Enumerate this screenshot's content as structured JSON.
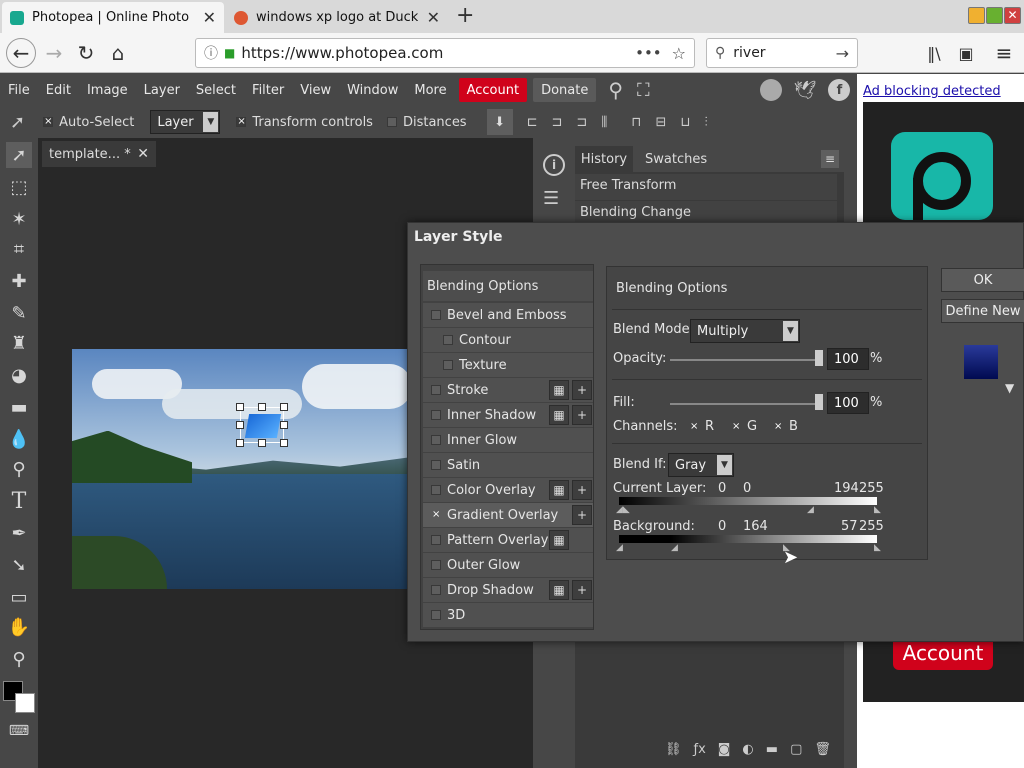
{
  "browser": {
    "tabs": [
      {
        "title": "Photopea | Online Photo Edit"
      },
      {
        "title": "windows xp logo at DuckDuc"
      }
    ],
    "new_tab": "+",
    "url": "https://www.photopea.com",
    "search": "river"
  },
  "menu": [
    "File",
    "Edit",
    "Image",
    "Layer",
    "Select",
    "Filter",
    "View",
    "Window",
    "More"
  ],
  "account_label": "Account",
  "donate_label": "Donate",
  "options": {
    "auto_select": "Auto-Select",
    "layer_select": "Layer",
    "transform_controls": "Transform controls",
    "distances": "Distances"
  },
  "document_tab": "template... *",
  "panel_tabs": {
    "history": "History",
    "swatches": "Swatches"
  },
  "history_items": [
    "Free Transform",
    "Blending Change"
  ],
  "ad": {
    "notice": "Ad blocking detected",
    "account": "Account"
  },
  "dialog": {
    "title": "Layer Style",
    "ok": "OK",
    "define_new": "Define New",
    "styles": [
      {
        "label": "Blending Options",
        "type": "header"
      },
      {
        "label": "Bevel and Emboss",
        "checked": false
      },
      {
        "label": "Contour",
        "checked": false,
        "sub": true
      },
      {
        "label": "Texture",
        "checked": false,
        "sub": true
      },
      {
        "label": "Stroke",
        "checked": false,
        "dup": true,
        "add": true
      },
      {
        "label": "Inner Shadow",
        "checked": false,
        "dup": true,
        "add": true
      },
      {
        "label": "Inner Glow",
        "checked": false
      },
      {
        "label": "Satin",
        "checked": false
      },
      {
        "label": "Color Overlay",
        "checked": false,
        "dup": true,
        "add": true
      },
      {
        "label": "Gradient Overlay",
        "checked": true,
        "add": true
      },
      {
        "label": "Pattern Overlay",
        "checked": false,
        "dup": true
      },
      {
        "label": "Outer Glow",
        "checked": false
      },
      {
        "label": "Drop Shadow",
        "checked": false,
        "dup": true,
        "add": true
      },
      {
        "label": "3D",
        "checked": false
      }
    ],
    "blending": {
      "heading": "Blending Options",
      "blend_mode_label": "Blend Mode:",
      "blend_mode": "Multiply",
      "opacity_label": "Opacity:",
      "opacity": "100",
      "fill_label": "Fill:",
      "fill": "100",
      "percent": "%",
      "channels_label": "Channels:",
      "channels": [
        "R",
        "G",
        "B"
      ],
      "blend_if_label": "Blend If:",
      "blend_if": "Gray",
      "current_layer_label": "Current Layer:",
      "current_layer_values": [
        "0",
        "0",
        "194",
        "255"
      ],
      "background_label": "Background:",
      "background_values": [
        "0",
        "164",
        "57",
        "255"
      ]
    }
  },
  "colors": {
    "account": "#d0021b",
    "accent": "#18b7a8",
    "bg": "#474747"
  }
}
